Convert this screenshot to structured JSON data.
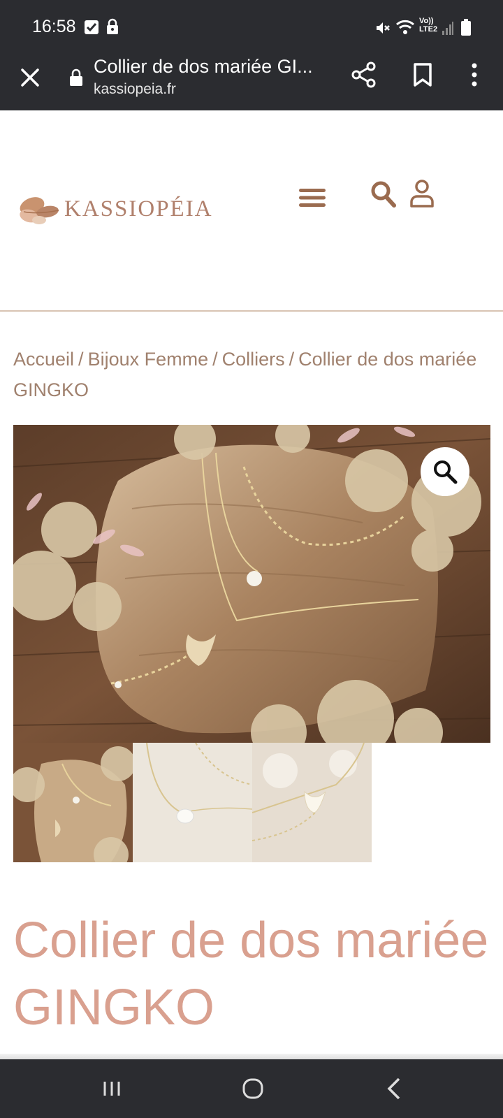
{
  "status_bar": {
    "time": "16:58",
    "icons": [
      "checkbox-notification-icon",
      "lock-notification-icon",
      "mute-icon",
      "wifi-calling-icon",
      "signal-icon",
      "battery-icon"
    ],
    "volte_label": "Vo))\nLTE2"
  },
  "toolbar": {
    "page_title": "Collier de dos mariée GI...",
    "url": "kassiopeia.fr"
  },
  "site": {
    "logo_text": "KASSIOPÉIA"
  },
  "breadcrumb": {
    "items": [
      "Accueil",
      "Bijoux Femme",
      "Colliers",
      "Collier de dos mariée GINGKO"
    ],
    "separator": "/"
  },
  "product": {
    "title": "Collier de dos mariée GINGKO",
    "thumbnail_count": 3
  },
  "colors": {
    "system_bar": "#2b2c30",
    "brand_brown": "#a0816e",
    "title_pink": "#d9a08f",
    "icon_brown": "#9a6b4f"
  }
}
